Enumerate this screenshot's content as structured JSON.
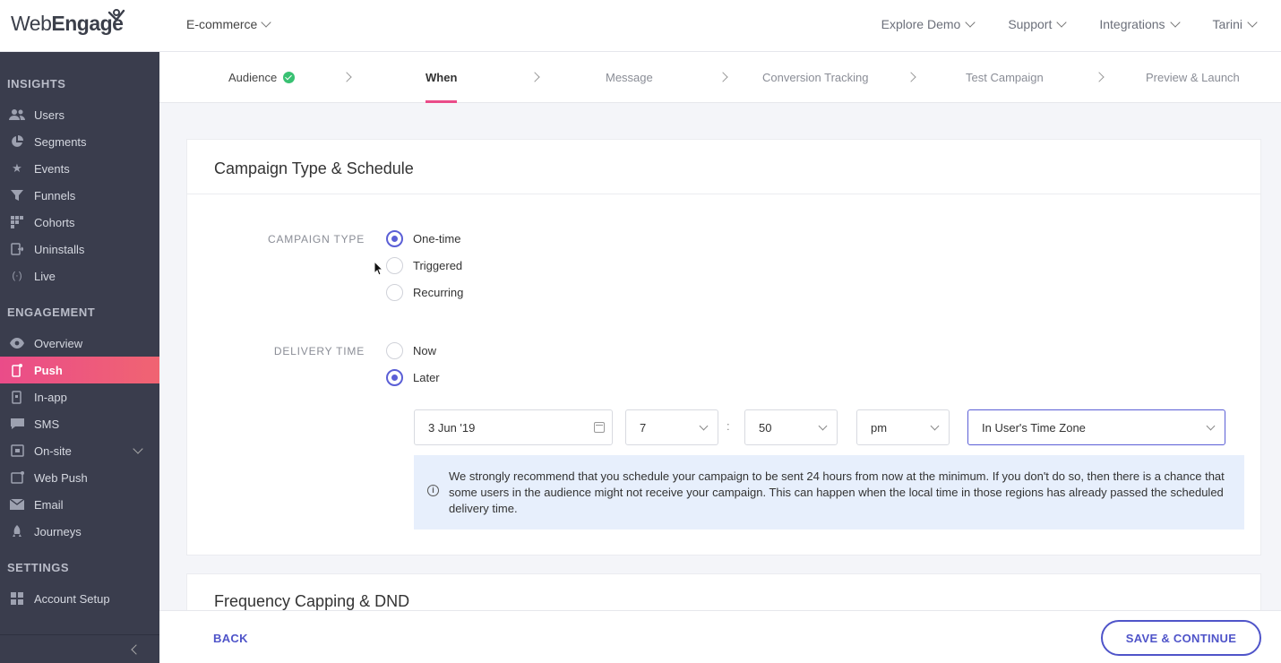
{
  "brand": {
    "name_part1": "Web",
    "name_part2": "Engage",
    "accent": "#ea4c89",
    "primary": "#4f54c9"
  },
  "project": {
    "name": "E-commerce"
  },
  "topnav": [
    "Explore Demo",
    "Support",
    "Integrations",
    "Tarini"
  ],
  "sidebar": {
    "sections": {
      "insights": "INSIGHTS",
      "engagement": "ENGAGEMENT",
      "settings": "SETTINGS"
    },
    "insights": [
      {
        "label": "Users",
        "icon": "users-icon"
      },
      {
        "label": "Segments",
        "icon": "pie-icon"
      },
      {
        "label": "Events",
        "icon": "star-icon"
      },
      {
        "label": "Funnels",
        "icon": "funnel-icon"
      },
      {
        "label": "Cohorts",
        "icon": "grid-icon"
      },
      {
        "label": "Uninstalls",
        "icon": "uninstall-icon"
      },
      {
        "label": "Live",
        "icon": "broadcast-icon"
      }
    ],
    "engagement": [
      {
        "label": "Overview",
        "icon": "eye-icon"
      },
      {
        "label": "Push",
        "icon": "mobile-icon",
        "active": true
      },
      {
        "label": "In-app",
        "icon": "inapp-icon"
      },
      {
        "label": "SMS",
        "icon": "sms-icon"
      },
      {
        "label": "On-site",
        "icon": "onsite-icon",
        "expandable": true
      },
      {
        "label": "Web Push",
        "icon": "webpush-icon"
      },
      {
        "label": "Email",
        "icon": "mail-icon"
      },
      {
        "label": "Journeys",
        "icon": "rocket-icon"
      }
    ],
    "settings": [
      {
        "label": "Account Setup",
        "icon": "grid-plus-icon"
      }
    ]
  },
  "steps": [
    {
      "label": "Audience",
      "state": "done"
    },
    {
      "label": "When",
      "state": "current"
    },
    {
      "label": "Message",
      "state": "pending"
    },
    {
      "label": "Conversion Tracking",
      "state": "pending"
    },
    {
      "label": "Test Campaign",
      "state": "pending"
    },
    {
      "label": "Preview & Launch",
      "state": "pending"
    }
  ],
  "schedule": {
    "title": "Campaign Type & Schedule",
    "campaign_type_label": "CAMPAIGN TYPE",
    "campaign_types": [
      "One-time",
      "Triggered",
      "Recurring"
    ],
    "campaign_type_selected": "One-time",
    "delivery_time_label": "DELIVERY TIME",
    "delivery_times": [
      "Now",
      "Later"
    ],
    "delivery_time_selected": "Later",
    "date": "3 Jun '19",
    "hour": "7",
    "minute": "50",
    "ampm": "pm",
    "timezone": "In User's Time Zone",
    "time_separator": ":",
    "info_text": "We strongly recommend that you schedule your campaign to be sent 24 hours from now at the minimum. If you don't do so, then there is a chance that some users in the audience might not receive your campaign. This can happen when the local time in those regions has already passed the scheduled delivery time."
  },
  "frequency": {
    "title": "Frequency Capping & DND"
  },
  "footer": {
    "back": "BACK",
    "save": "SAVE & CONTINUE"
  }
}
